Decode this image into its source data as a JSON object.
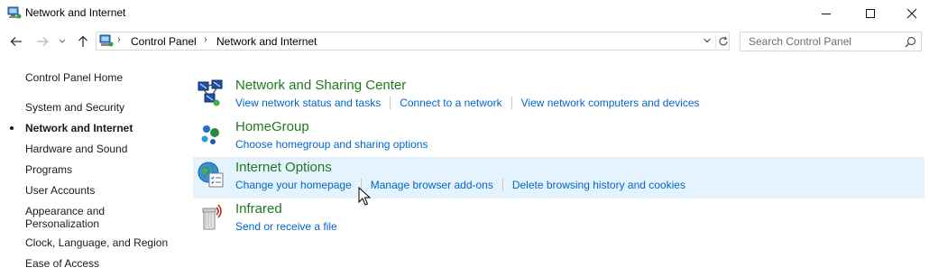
{
  "window": {
    "title": "Network and Internet",
    "controls": {
      "minimize": "minimize-icon",
      "maximize": "maximize-icon",
      "close": "close-icon"
    }
  },
  "navigation": {
    "back": "back-arrow-icon",
    "forward": "forward-arrow-icon",
    "recent": "chevron-down-icon",
    "up": "up-arrow-icon"
  },
  "address": {
    "crumbs": [
      "Control Panel",
      "Network and Internet"
    ],
    "separator": "›"
  },
  "search": {
    "placeholder": "Search Control Panel"
  },
  "sidebar": {
    "items": [
      {
        "label": "Control Panel Home",
        "active": false
      },
      {
        "label": "System and Security",
        "active": false
      },
      {
        "label": "Network and Internet",
        "active": true
      },
      {
        "label": "Hardware and Sound",
        "active": false
      },
      {
        "label": "Programs",
        "active": false
      },
      {
        "label": "User Accounts",
        "active": false
      },
      {
        "label": "Appearance and Personalization",
        "active": false
      },
      {
        "label": "Clock, Language, and Region",
        "active": false
      },
      {
        "label": "Ease of Access",
        "active": false
      }
    ]
  },
  "categories": [
    {
      "title": "Network and Sharing Center",
      "icon": "network-sharing-icon",
      "links": [
        "View network status and tasks",
        "Connect to a network",
        "View network computers and devices"
      ]
    },
    {
      "title": "HomeGroup",
      "icon": "homegroup-icon",
      "links": [
        "Choose homegroup and sharing options"
      ]
    },
    {
      "title": "Internet Options",
      "icon": "internet-options-icon",
      "hovered": true,
      "links": [
        "Change your homepage",
        "Manage browser add-ons",
        "Delete browsing history and cookies"
      ]
    },
    {
      "title": "Infrared",
      "icon": "infrared-icon",
      "links": [
        "Send or receive a file"
      ]
    }
  ],
  "colors": {
    "category_title": "#1e7a1e",
    "link": "#0066cc",
    "hover_background": "#e5f3ff"
  }
}
